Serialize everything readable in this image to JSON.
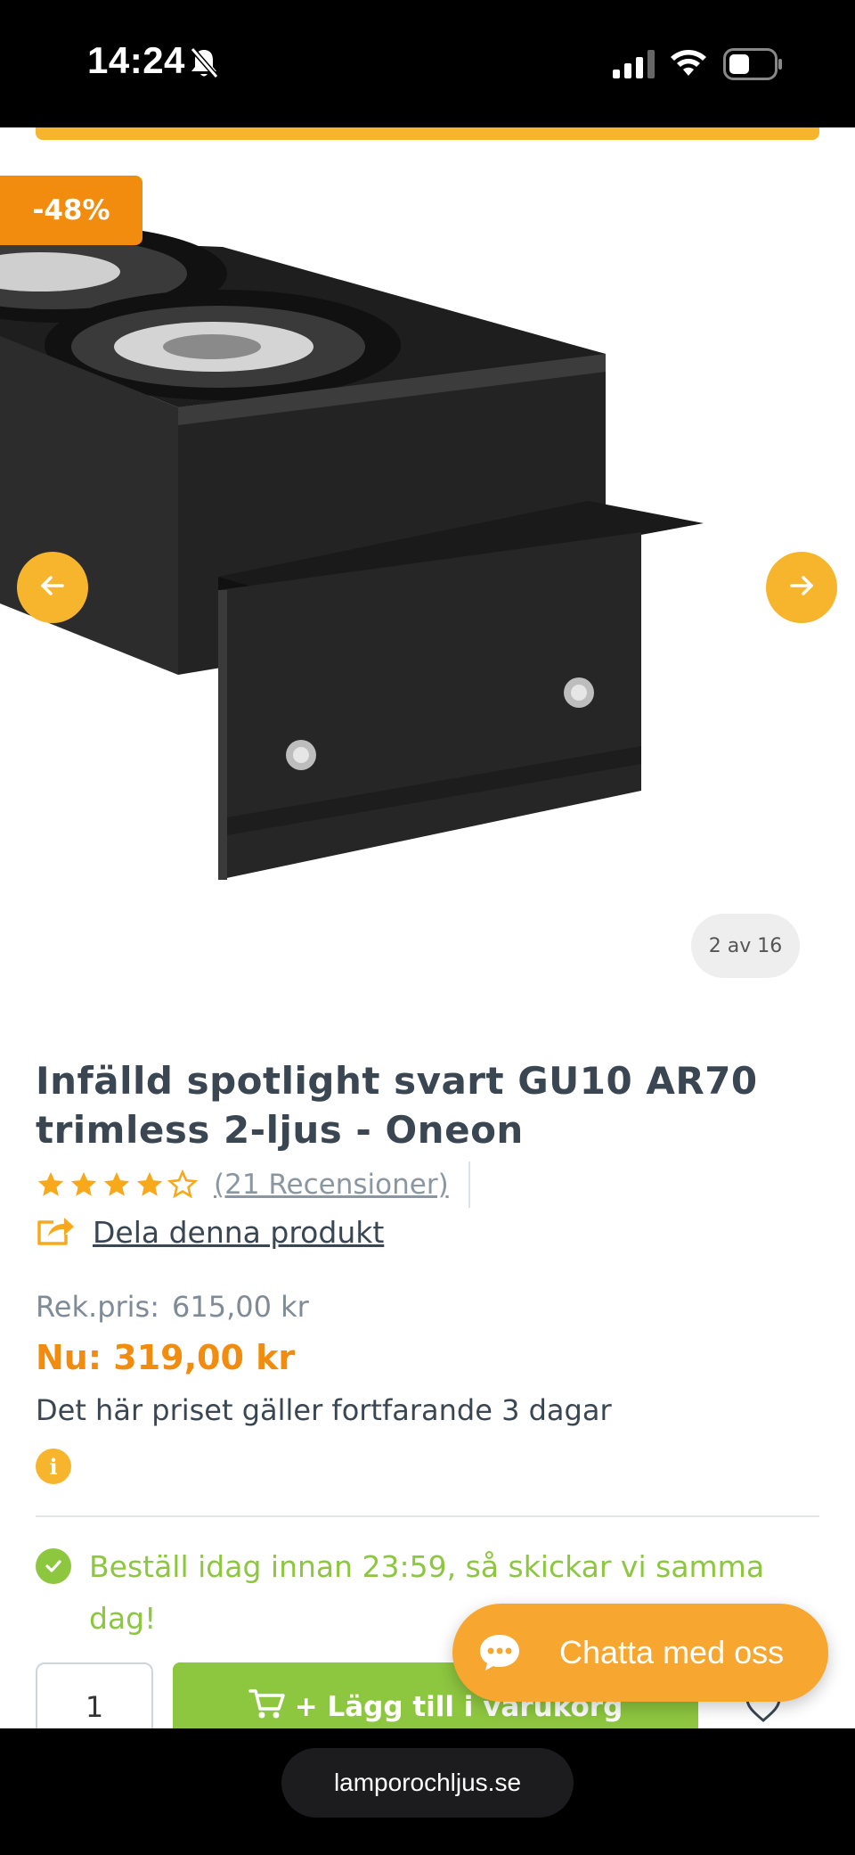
{
  "status_bar": {
    "time": "14:24",
    "icons": [
      "bell-slash-icon",
      "signal-icon",
      "wifi-icon",
      "battery-icon"
    ]
  },
  "gallery": {
    "discount_badge": "-48%",
    "counter": "2 av 16",
    "image_subject": "black recessed double spotlight",
    "prev_icon": "arrow-left-icon",
    "next_icon": "arrow-right-icon"
  },
  "product": {
    "title": "Infälld spotlight svart GU10 AR70 trimless 2-ljus - Oneon",
    "rating": 4.5,
    "rating_max": 5,
    "reviews_label": "(21 Recensioner)",
    "share_label": "Dela denna produkt"
  },
  "pricing": {
    "rek_label": "Rek.pris:",
    "rek_value": "615,00 kr",
    "now_label": "Nu: 319,00 kr",
    "validity": "Det här priset gäller fortfarande 3 dagar"
  },
  "delivery": {
    "message": "Beställ idag innan 23:59, så skickar vi samma dag!"
  },
  "purchase": {
    "quantity": "1",
    "add_to_cart_label": "+ Lägg till i varukorg"
  },
  "chat": {
    "label": "Chatta med oss"
  },
  "browser": {
    "url": "lamporochljus.se"
  },
  "colors": {
    "accent_orange": "#f28c0f",
    "accent_yellow": "#f7b52d",
    "success_green": "#8dc63f",
    "text_dark": "#3a4651"
  }
}
